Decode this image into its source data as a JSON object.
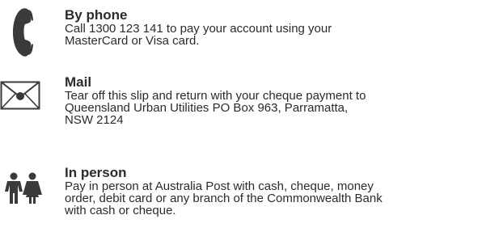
{
  "methods": [
    {
      "heading": "By phone",
      "lines": [
        "Call 1300 123 141 to pay your account using your",
        "MasterCard or Visa card."
      ],
      "icon": "telephone-handset-icon"
    },
    {
      "heading": "Mail",
      "lines": [
        "Tear off this slip and return with your cheque payment to",
        "Queensland Urban Utilities PO Box 963, Parramatta,",
        "NSW 2124"
      ],
      "icon": "envelope-icon"
    },
    {
      "heading": "In person",
      "lines": [
        "Pay in person at Australia Post with cash, cheque, money",
        "order, debit card or any branch of the Commonwealth Bank",
        "with cash or cheque."
      ],
      "icon": "people-icon"
    }
  ],
  "colors": {
    "text": "#2b2b2b",
    "icon": "#3a3a3a"
  }
}
